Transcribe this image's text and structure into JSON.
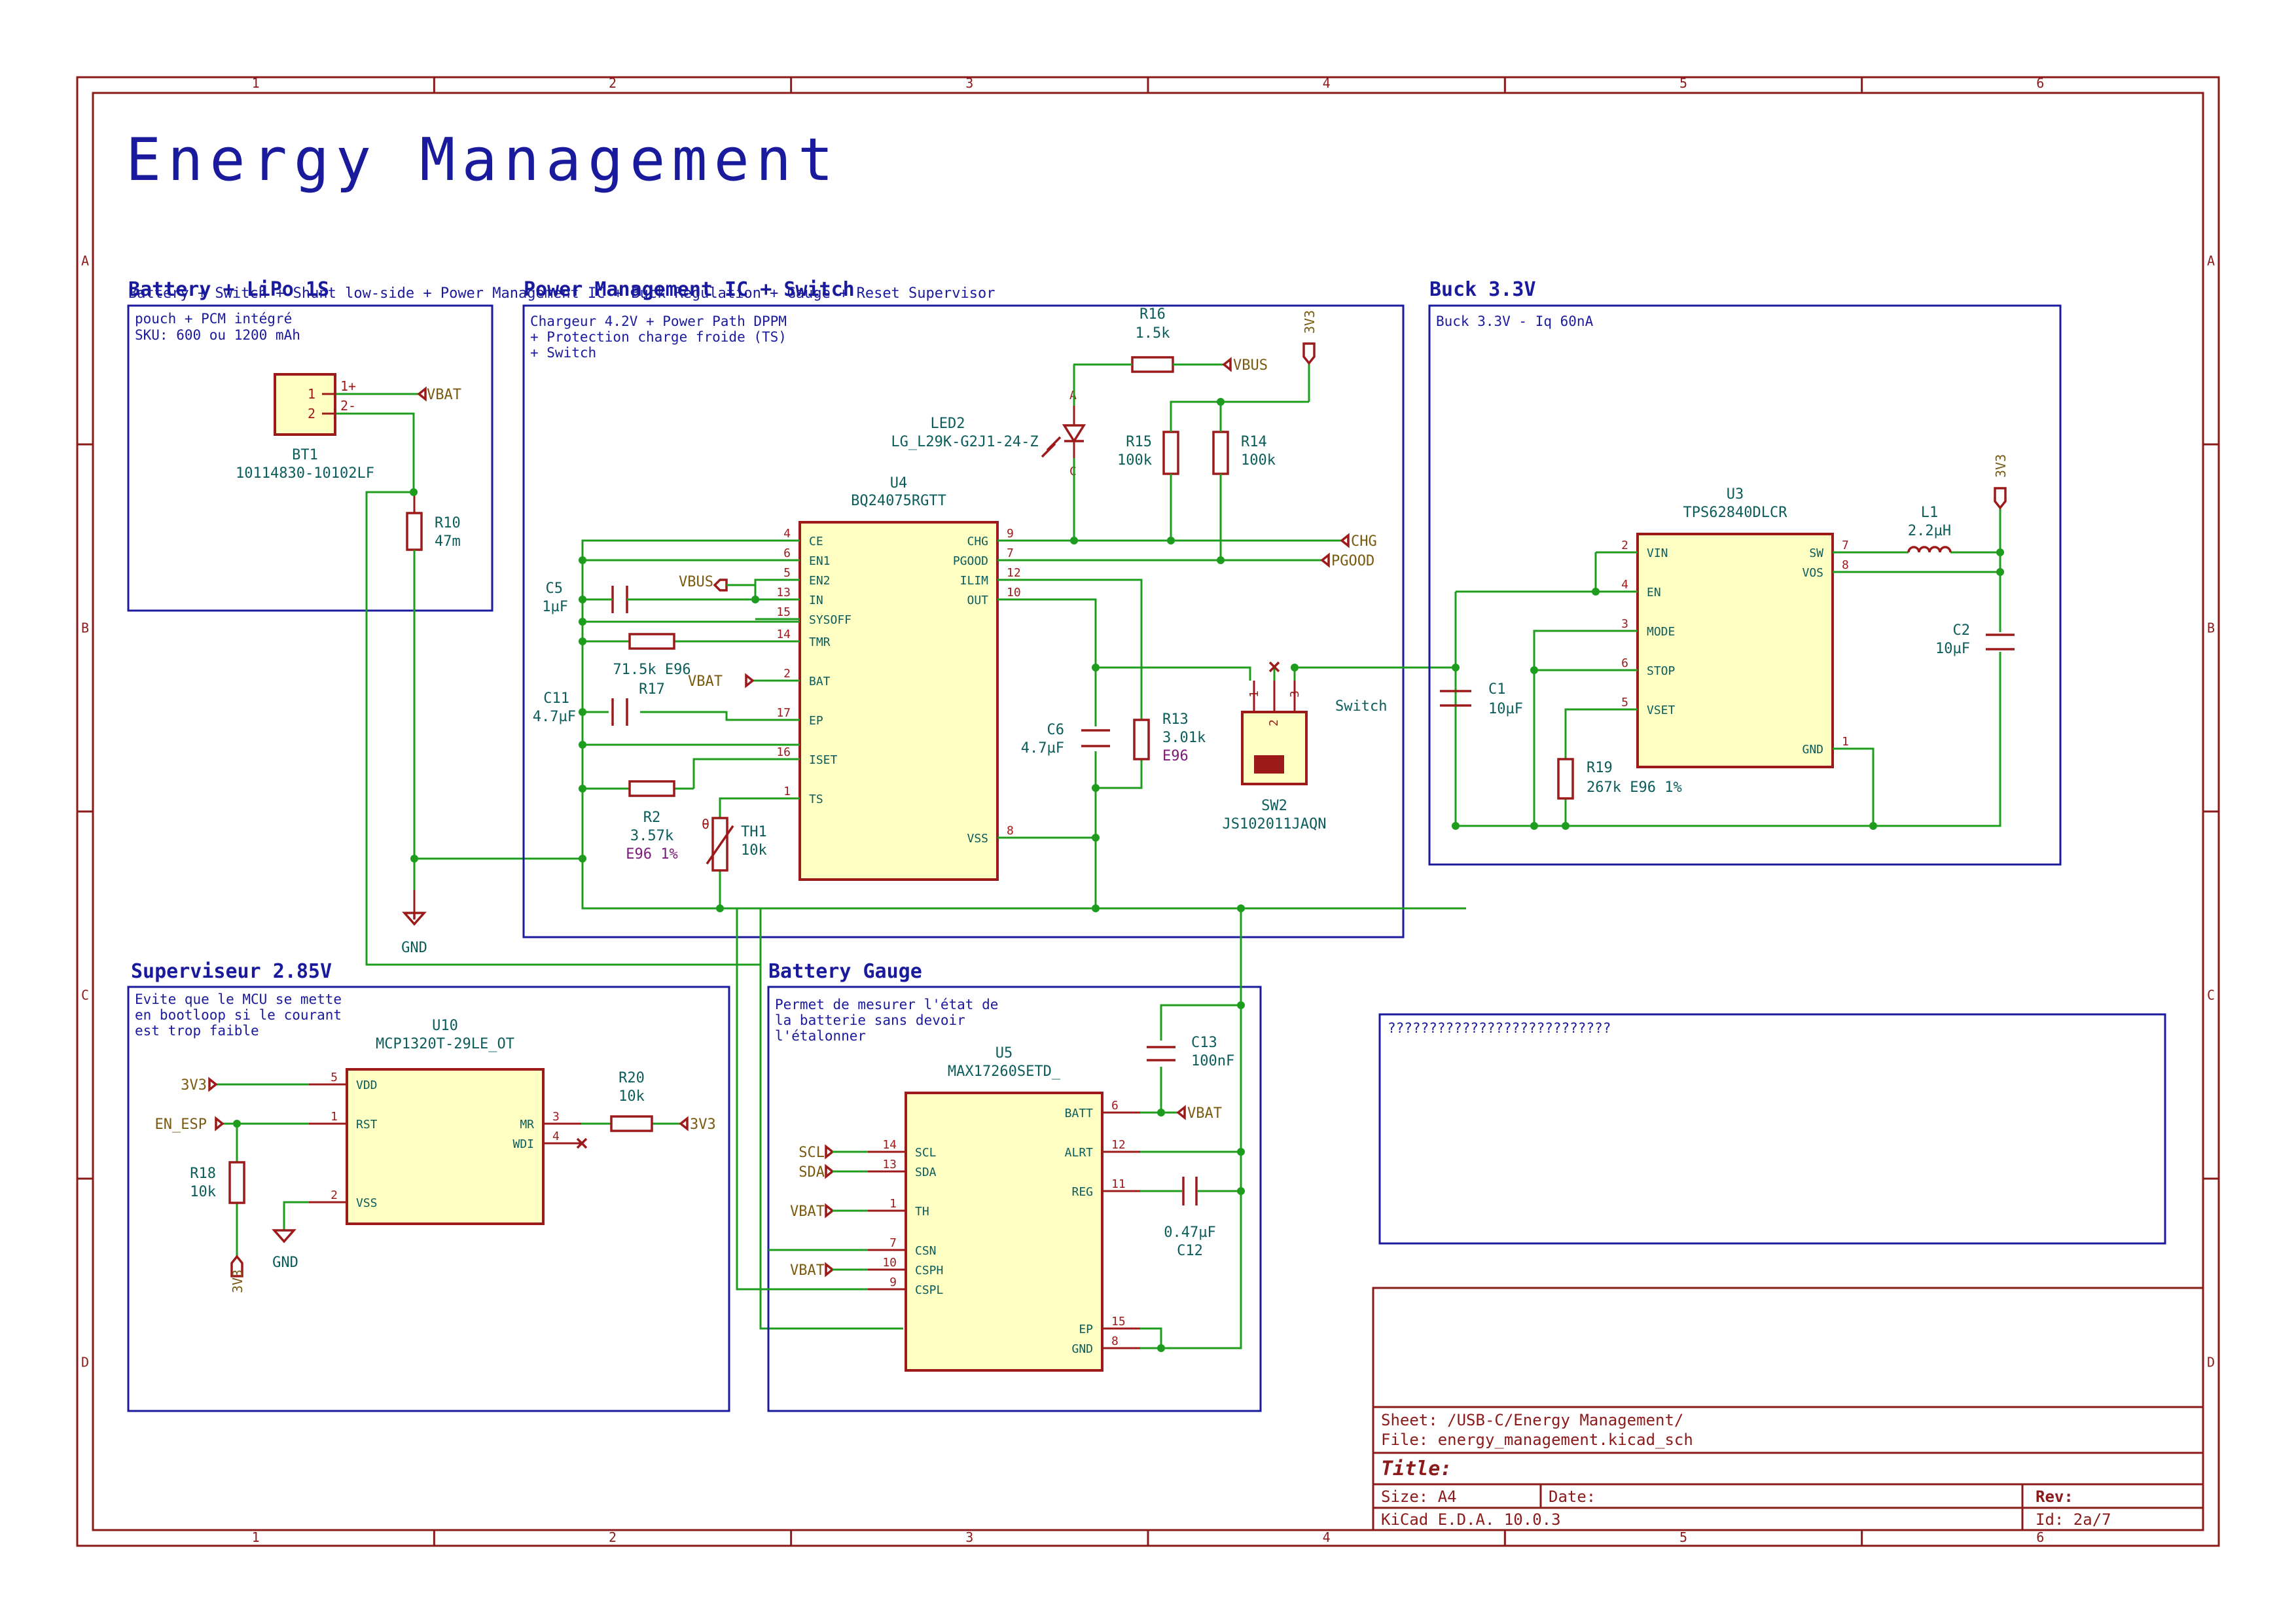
{
  "sheet": {
    "title": "Energy Management",
    "columns": [
      "1",
      "2",
      "3",
      "4",
      "5",
      "6"
    ],
    "rows": [
      "A",
      "B",
      "C",
      "D"
    ]
  },
  "colors": {
    "frame": "#8b1a1a",
    "wire": "#1e9c1e",
    "hierarchy": "#1a1a9c",
    "component_body": "#ffffc4",
    "component_outline": "#9c1a1a"
  },
  "sections": {
    "battery": {
      "title": "Battery + LiPo 1S",
      "overlap_text": "Battery + Switch + Shunt low-side + Power Management IC + Buck Regulation + Gauge + Reset Supervisor",
      "desc": [
        "pouch + PCM intégré",
        "SKU: 600 ou 1200 mAh"
      ]
    },
    "pmic": {
      "title": "Power Management IC + Switch",
      "desc": [
        "Chargeur 4.2V + Power Path DPPM",
        "+ Protection charge froide (TS)",
        "+ Switch"
      ]
    },
    "buck": {
      "title": "Buck 3.3V",
      "desc": [
        "Buck 3.3V - Iq 60nA"
      ]
    },
    "supervisor": {
      "title": "Superviseur 2.85V",
      "desc": [
        "Evite que le MCU se mette",
        "en bootloop si le courant",
        "est trop faible"
      ]
    },
    "gauge": {
      "title": "Battery Gauge",
      "desc": [
        "Permet de mesurer l'état de",
        "la batterie sans devoir",
        "l'étalonner"
      ]
    },
    "note_box": "???????????????????????????"
  },
  "components": {
    "BT1": {
      "ref": "BT1",
      "value": "10114830-10102LF",
      "pins": [
        "1",
        "2"
      ],
      "pin_labels": [
        "1+",
        "2-"
      ]
    },
    "R10": {
      "ref": "R10",
      "value": "47m"
    },
    "U4": {
      "ref": "U4",
      "value": "BQ24075RGTT",
      "left_pins": [
        {
          "num": "4",
          "name": "CE"
        },
        {
          "num": "6",
          "name": "EN1"
        },
        {
          "num": "5",
          "name": "EN2"
        },
        {
          "num": "13",
          "name": "IN"
        },
        {
          "num": "15",
          "name": "SYSOFF"
        },
        {
          "num": "14",
          "name": "TMR"
        },
        {
          "num": "2",
          "name": "BAT"
        },
        {
          "num": "17",
          "name": "EP"
        },
        {
          "num": "16",
          "name": "ISET"
        },
        {
          "num": "1",
          "name": "TS"
        }
      ],
      "right_pins": [
        {
          "num": "9",
          "name": "CHG"
        },
        {
          "num": "7",
          "name": "PGOOD"
        },
        {
          "num": "12",
          "name": "ILIM"
        },
        {
          "num": "10",
          "name": "OUT"
        },
        {
          "num": "8",
          "name": "VSS"
        }
      ]
    },
    "C5": {
      "ref": "C5",
      "value": "1µF"
    },
    "R17": {
      "ref": "R17",
      "value": "71.5k E96"
    },
    "C11": {
      "ref": "C11",
      "value": "4.7µF"
    },
    "R2": {
      "ref": "R2",
      "value": "3.57k",
      "tol": "E96 1%"
    },
    "TH1": {
      "ref": "TH1",
      "value": "10k",
      "mark": "θ"
    },
    "R16": {
      "ref": "R16",
      "value": "1.5k"
    },
    "LED2": {
      "ref": "LED2",
      "value": "LG_L29K-G2J1-24-Z",
      "a": "A",
      "c": "C"
    },
    "R15": {
      "ref": "R15",
      "value": "100k"
    },
    "R14": {
      "ref": "R14",
      "value": "100k"
    },
    "C6": {
      "ref": "C6",
      "value": "4.7µF"
    },
    "R13": {
      "ref": "R13",
      "value": "3.01k",
      "tol": "E96"
    },
    "SW2": {
      "ref": "SW2",
      "value": "JS102011JAQN",
      "label": "Switch",
      "pins": [
        "1",
        "2",
        "3"
      ]
    },
    "U3": {
      "ref": "U3",
      "value": "TPS62840DLCR",
      "left_pins": [
        {
          "num": "2",
          "name": "VIN"
        },
        {
          "num": "4",
          "name": "EN"
        },
        {
          "num": "3",
          "name": "MODE"
        },
        {
          "num": "6",
          "name": "STOP"
        },
        {
          "num": "5",
          "name": "VSET"
        }
      ],
      "right_pins": [
        {
          "num": "7",
          "name": "SW"
        },
        {
          "num": "8",
          "name": "VOS"
        },
        {
          "num": "1",
          "name": "GND"
        }
      ]
    },
    "L1": {
      "ref": "L1",
      "value": "2.2µH"
    },
    "C2": {
      "ref": "C2",
      "value": "10µF"
    },
    "C1": {
      "ref": "C1",
      "value": "10µF"
    },
    "R19": {
      "ref": "R19",
      "value": "267k E96 1%"
    },
    "U10": {
      "ref": "U10",
      "value": "MCP1320T-29LE_OT",
      "left_pins": [
        {
          "num": "5",
          "name": "VDD"
        },
        {
          "num": "1",
          "name": "RST"
        },
        {
          "num": "2",
          "name": "VSS"
        }
      ],
      "right_pins": [
        {
          "num": "3",
          "name": "MR"
        },
        {
          "num": "4",
          "name": "WDI"
        }
      ]
    },
    "R20": {
      "ref": "R20",
      "value": "10k"
    },
    "R18": {
      "ref": "R18",
      "value": "10k"
    },
    "U5": {
      "ref": "U5",
      "value": "MAX17260SETD_",
      "left_pins": [
        {
          "num": "14",
          "name": "SCL"
        },
        {
          "num": "13",
          "name": "SDA"
        },
        {
          "num": "1",
          "name": "TH"
        },
        {
          "num": "7",
          "name": "CSN"
        },
        {
          "num": "10",
          "name": "CSPH"
        },
        {
          "num": "9",
          "name": "CSPL"
        }
      ],
      "right_pins": [
        {
          "num": "6",
          "name": "BATT"
        },
        {
          "num": "12",
          "name": "ALRT"
        },
        {
          "num": "11",
          "name": "REG"
        },
        {
          "num": "15",
          "name": "EP"
        },
        {
          "num": "8",
          "name": "GND"
        }
      ]
    },
    "C13": {
      "ref": "C13",
      "value": "100nF"
    },
    "C12": {
      "ref": "C12",
      "value": "0.47µF"
    }
  },
  "nets": {
    "VBAT": "VBAT",
    "VBUS": "VBUS",
    "V3V3": "3V3",
    "GND": "GND",
    "CHG": "CHG",
    "PGOOD": "PGOOD",
    "EN_ESP": "EN_ESP",
    "SCL": "SCL",
    "SDA": "SDA"
  },
  "title_block": {
    "sheet": "Sheet: /USB-C/Energy Management/",
    "file": "File: energy_management.kicad_sch",
    "title_label": "Title:",
    "size": "Size: A4",
    "date": "Date:",
    "rev": "Rev:",
    "tool": "KiCad E.D.A. 10.0.3",
    "id": "Id: 2a/7"
  }
}
